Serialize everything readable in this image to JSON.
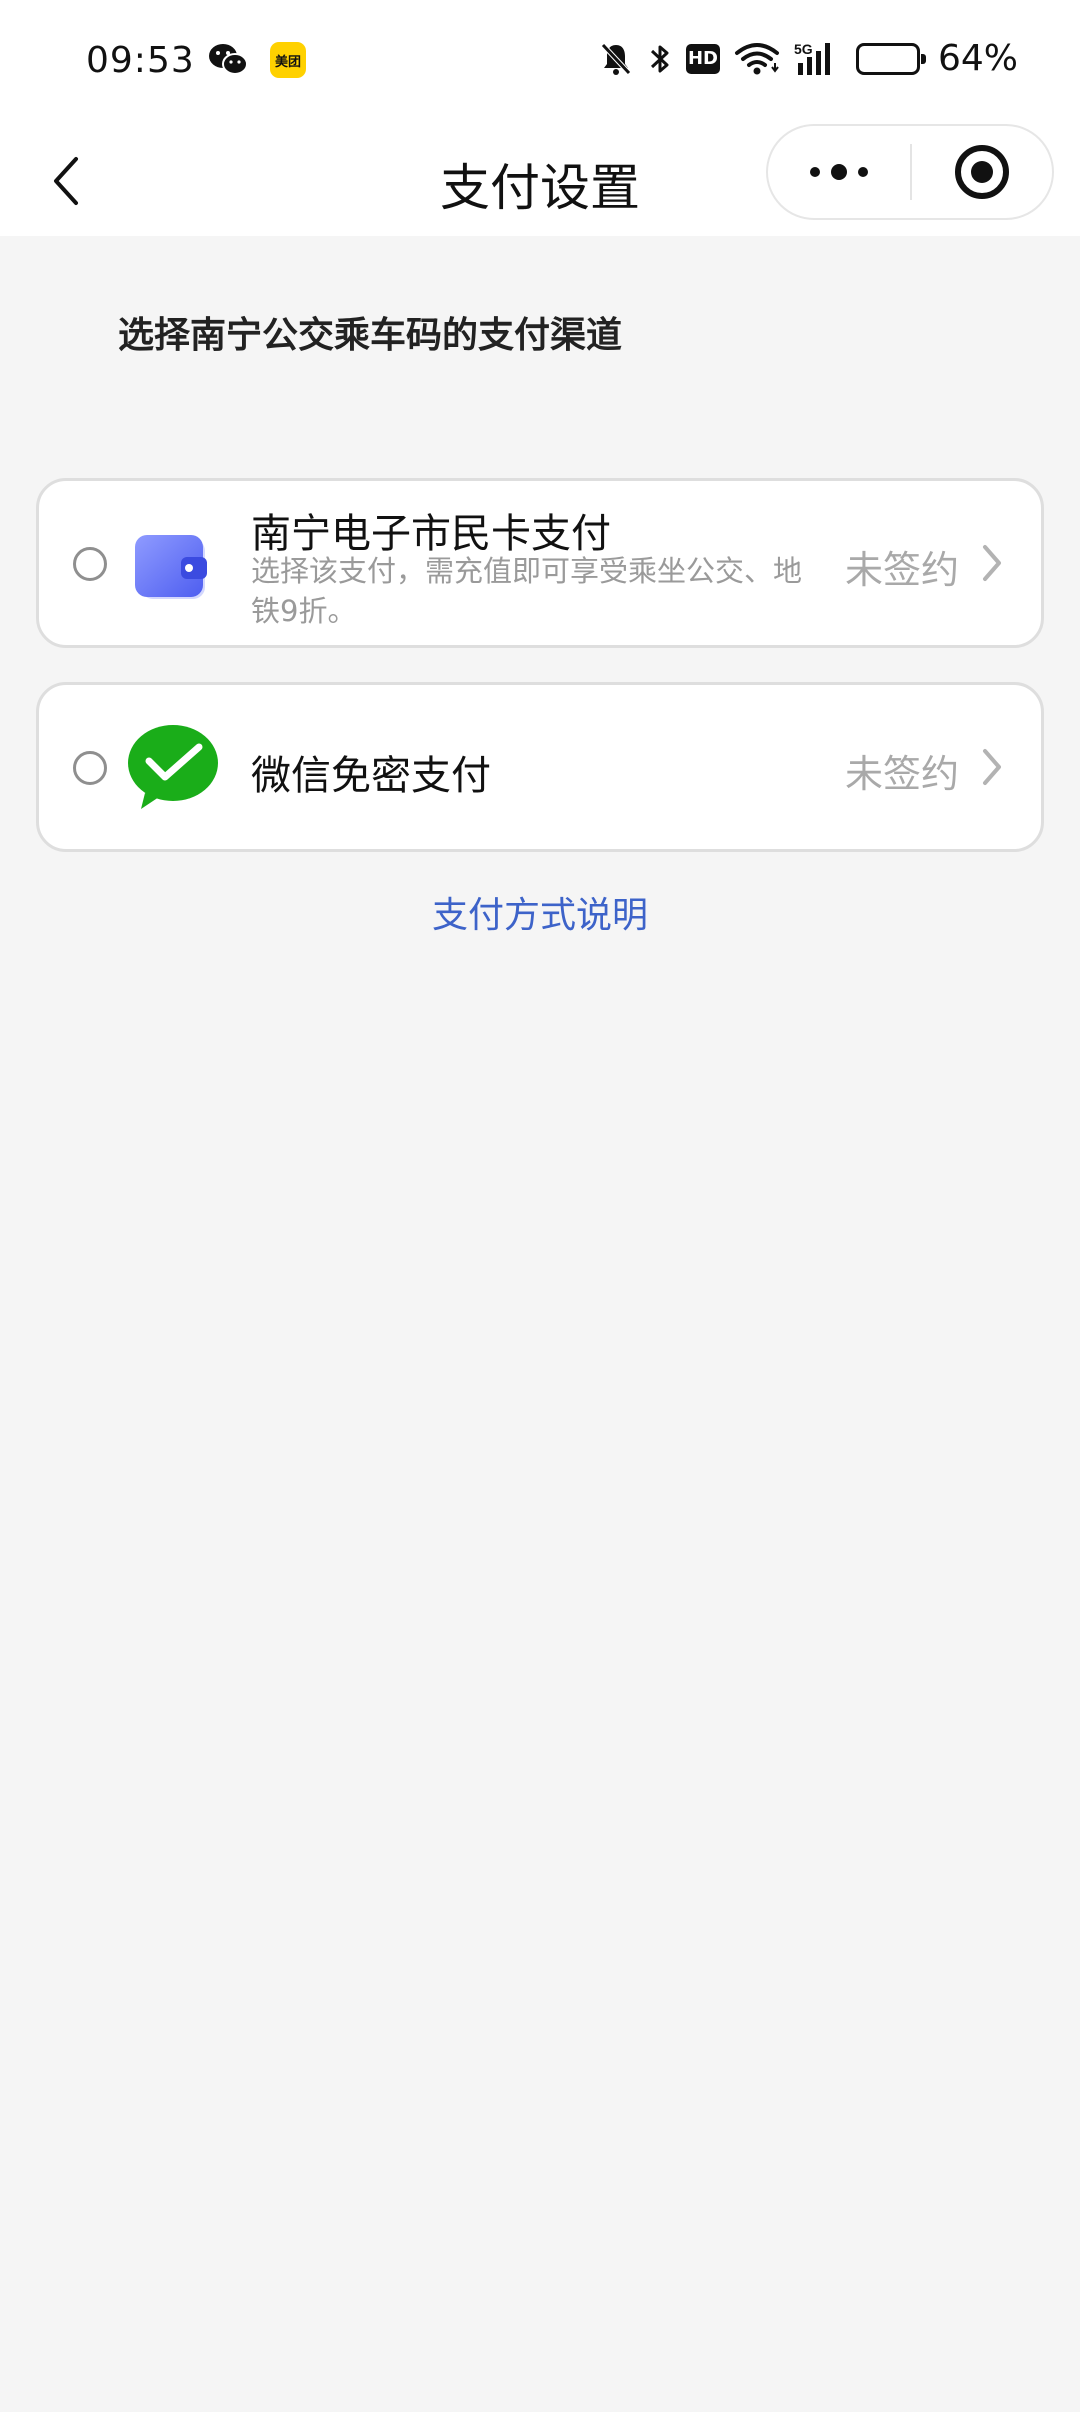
{
  "statusbar": {
    "time": "09:53",
    "meituan": "美团",
    "battery_percent": "64%",
    "battery_level": 0.64,
    "icons": [
      "wechat-icon",
      "meituan-icon",
      "mute-bell-icon",
      "bluetooth-icon",
      "hd-icon",
      "wifi-icon",
      "signal-5g-icon",
      "battery-icon"
    ],
    "hd": "HD",
    "network": "5G"
  },
  "navbar": {
    "title": "支付设置",
    "icons": [
      "back-arrow-icon",
      "more-dots-icon",
      "target-icon"
    ]
  },
  "main": {
    "section_title": "选择南宁公交乘车码的支付渠道",
    "options": [
      {
        "name": "南宁电子市民卡支付",
        "description": "选择该支付，需充值即可享受乘坐公交、地铁9折。",
        "status": "未签约",
        "icon": "wallet-icon",
        "selected": false
      },
      {
        "name": "微信免密支付",
        "description": "",
        "status": "未签约",
        "icon": "wechat-pay-icon",
        "selected": false
      }
    ],
    "help_link": "支付方式说明"
  },
  "colors": {
    "link": "#3d63c9",
    "wechat_green": "#1aad19",
    "wallet_blue": "#5b6cf5",
    "background": "#f5f5f5"
  }
}
